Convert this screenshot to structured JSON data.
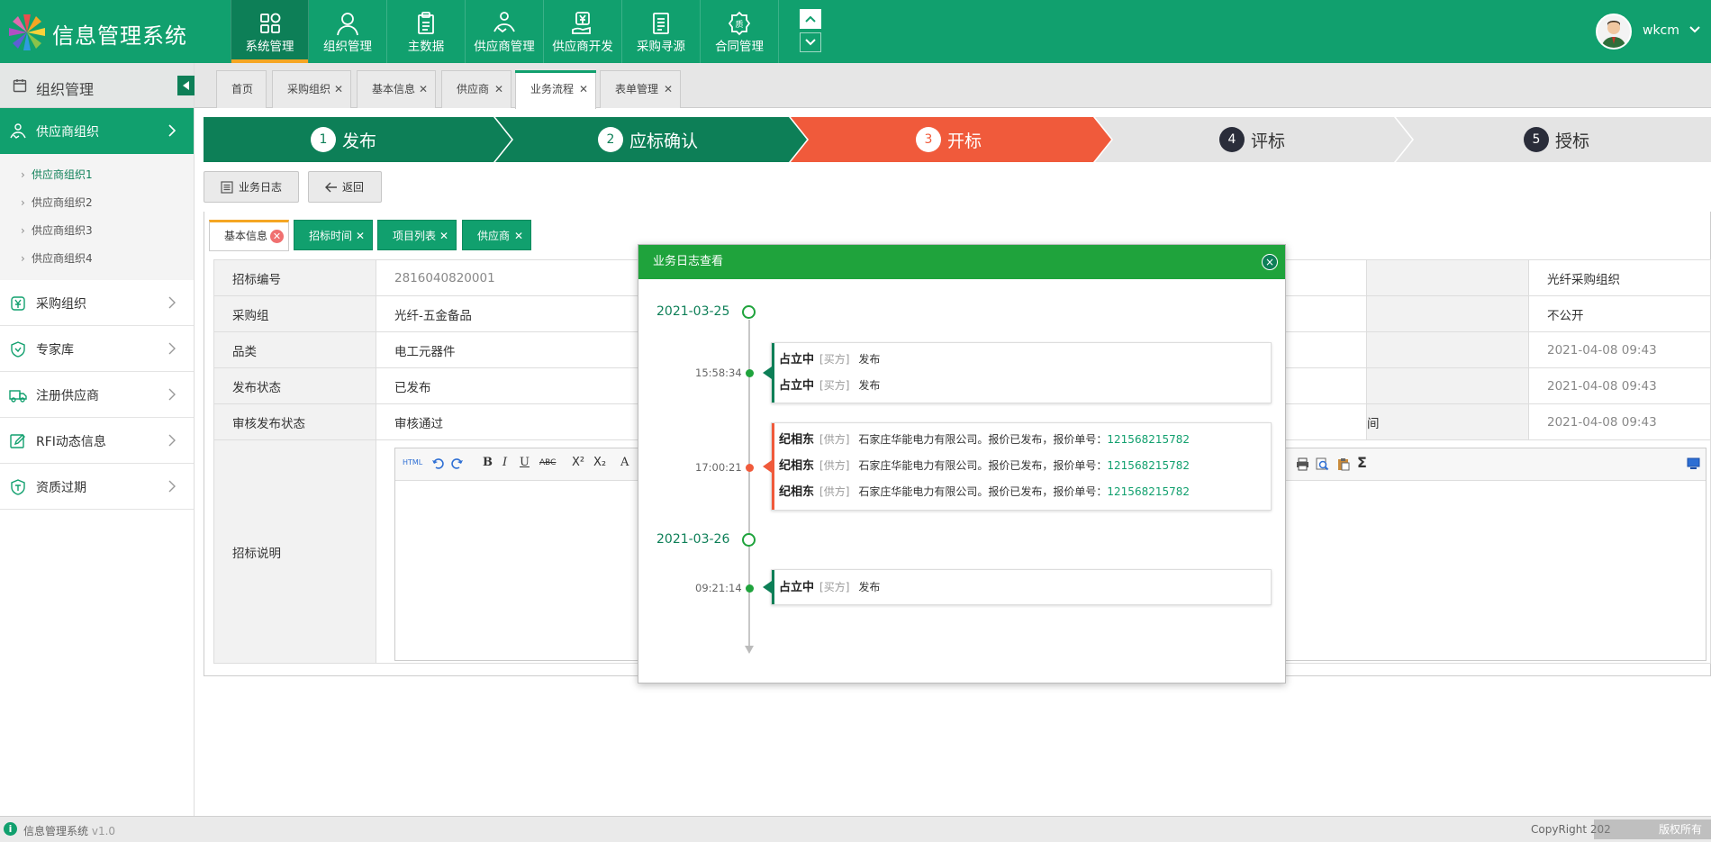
{
  "app": {
    "title": "信息管理系统"
  },
  "nav": [
    {
      "label": "系统管理",
      "icon": "grid-icon",
      "active": true
    },
    {
      "label": "组织管理",
      "icon": "user-icon"
    },
    {
      "label": "主数据",
      "icon": "clipboard-icon"
    },
    {
      "label": "供应商管理",
      "icon": "handshake-icon"
    },
    {
      "label": "供应商开发",
      "icon": "yen-hand-icon"
    },
    {
      "label": "采购寻源",
      "icon": "document-icon"
    },
    {
      "label": "合同管理",
      "icon": "quality-badge-icon"
    }
  ],
  "user": {
    "name": "wkcm"
  },
  "sidebar": {
    "title": "组织管理",
    "items": [
      {
        "label": "供应商组织",
        "active": true
      },
      {
        "label": "采购组织"
      },
      {
        "label": "专家库"
      },
      {
        "label": "注册供应商"
      },
      {
        "label": "RFI动态信息"
      },
      {
        "label": "资质过期"
      }
    ],
    "subitems": [
      "供应商组织1",
      "供应商组织2",
      "供应商组织3",
      "供应商组织4"
    ]
  },
  "tabs": [
    "首页",
    "采购组织",
    "基本信息",
    "供应商",
    "业务流程",
    "表单管理"
  ],
  "steps": [
    {
      "num": "1",
      "label": "发布"
    },
    {
      "num": "2",
      "label": "应标确认"
    },
    {
      "num": "3",
      "label": "开标"
    },
    {
      "num": "4",
      "label": "评标"
    },
    {
      "num": "5",
      "label": "授标"
    }
  ],
  "buttons": {
    "log": "业务日志",
    "back": "返回"
  },
  "subtabs": [
    "基本信息",
    "招标时间",
    "项目列表",
    "供应商"
  ],
  "form": {
    "rows": [
      {
        "label": "招标编号",
        "value": "2816040820001",
        "right_value": "光纤采购组织"
      },
      {
        "label": "采购组",
        "value": "光纤-五金备品",
        "right_value": "不公开"
      },
      {
        "label": "品类",
        "value": "电工元器件",
        "right_value": "2021-04-08 09:43"
      },
      {
        "label": "发布状态",
        "value": "已发布",
        "right_value": "2021-04-08 09:43"
      },
      {
        "label": "审核发布状态",
        "value": "审核通过",
        "right_label_tail": "间",
        "right_value": "2021-04-08 09:43"
      }
    ],
    "desc_label": "招标说明"
  },
  "editor_toolbar": {
    "html": "HTML",
    "bold": "B",
    "italic": "I",
    "underline": "U",
    "strike": "ABC",
    "sup": "X²",
    "sub": "X₂",
    "font": "A",
    "sum": "Σ"
  },
  "modal": {
    "title": "业务日志查看",
    "close": "×",
    "dates": [
      "2021-03-25",
      "2021-03-26"
    ],
    "entries": [
      {
        "time": "15:58:34",
        "rows": [
          {
            "name": "占立中",
            "role": "[买方]",
            "action": "发布"
          },
          {
            "name": "占立中",
            "role": "[买方]",
            "action": "发布"
          }
        ]
      },
      {
        "time": "17:00:21",
        "rows": [
          {
            "name": "纪相东",
            "role": "[供方]",
            "action": "石家庄华能电力有限公司。报价已发布，报价单号：",
            "no": "121568215782"
          },
          {
            "name": "纪相东",
            "role": "[供方]",
            "action": "石家庄华能电力有限公司。报价已发布，报价单号：",
            "no": "121568215782"
          },
          {
            "name": "纪相东",
            "role": "[供方]",
            "action": "石家庄华能电力有限公司。报价已发布，报价单号：",
            "no": "121568215782"
          }
        ]
      },
      {
        "time": "09:21:14",
        "rows": [
          {
            "name": "占立中",
            "role": "[买方]",
            "action": "发布"
          }
        ]
      }
    ]
  },
  "footer": {
    "name": "信息管理系统",
    "version": "v1.0",
    "copyright": "CopyRight 202",
    "watermark": "版权所有"
  },
  "colors": {
    "primary": "#11a06e",
    "dark": "#0d7f57",
    "active_step": "#f05a3b",
    "modal_head": "#1fa33c",
    "accent": "#f5a623"
  }
}
